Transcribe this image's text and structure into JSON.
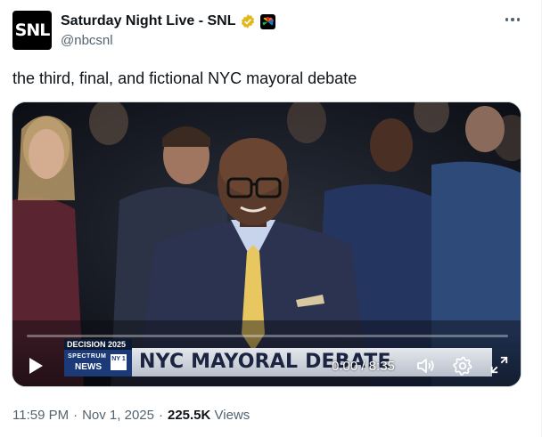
{
  "post": {
    "display_name": "Saturday Night Live - SNL",
    "handle": "@nbcsnl",
    "avatar_text": "SNL",
    "text": "the third, final, and fictional NYC mayoral debate",
    "time": "11:59 PM",
    "separator": "·",
    "date": "Nov 1, 2025",
    "views_count": "225.5K",
    "views_label": "Views"
  },
  "video": {
    "chyron_label": "DECISION 2025",
    "bug_top": "SPECTRUM",
    "bug_bottom": "NEWS",
    "bug_ny": "NY 1",
    "chyron_title": "NYC MAYORAL DEBATE",
    "time_display": "0:00 / 8:35",
    "progress": 0
  },
  "colors": {
    "verified_gold": "#e2b719",
    "secondary_text": "#536471",
    "primary_text": "#0f1419"
  },
  "icons": [
    "verified-badge-icon",
    "nbc-affiliate-icon",
    "more-icon",
    "play-icon",
    "volume-icon",
    "gear-icon",
    "fullscreen-icon"
  ]
}
